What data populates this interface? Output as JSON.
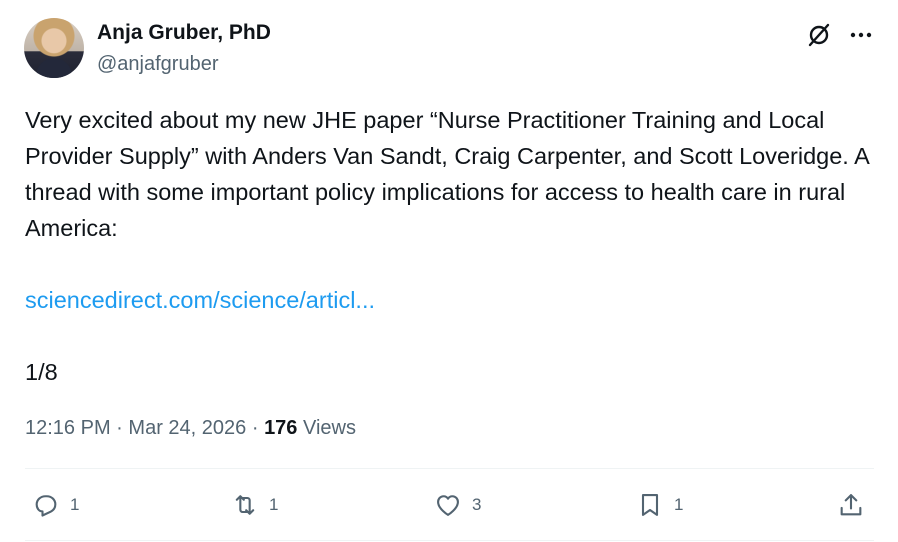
{
  "author": {
    "name": "Anja Gruber, PhD",
    "handle": "@anjafgruber"
  },
  "post": {
    "text": "Very excited about my new JHE paper “Nurse Practitioner Training and Local Provider Supply” with Anders Van Sandt, Craig Carpenter, and Scott Loveridge. A thread with some important policy implications for access to health care in rural America:",
    "link": "sciencedirect.com/science/articl...",
    "thread_counter": "1/8"
  },
  "meta": {
    "time": "12:16 PM",
    "separator": "·",
    "date": "Mar 24, 2026",
    "views_count": "176",
    "views_label": "Views"
  },
  "actions": {
    "replies": "1",
    "reposts": "1",
    "likes": "3",
    "bookmarks": "1"
  },
  "colors": {
    "text": "#0f1419",
    "secondary": "#536471",
    "link": "#1d9bf0",
    "divider": "#eff3f4"
  },
  "icons": [
    "grok-icon",
    "more-icon",
    "reply-icon",
    "repost-icon",
    "like-icon",
    "bookmark-icon",
    "share-icon"
  ]
}
